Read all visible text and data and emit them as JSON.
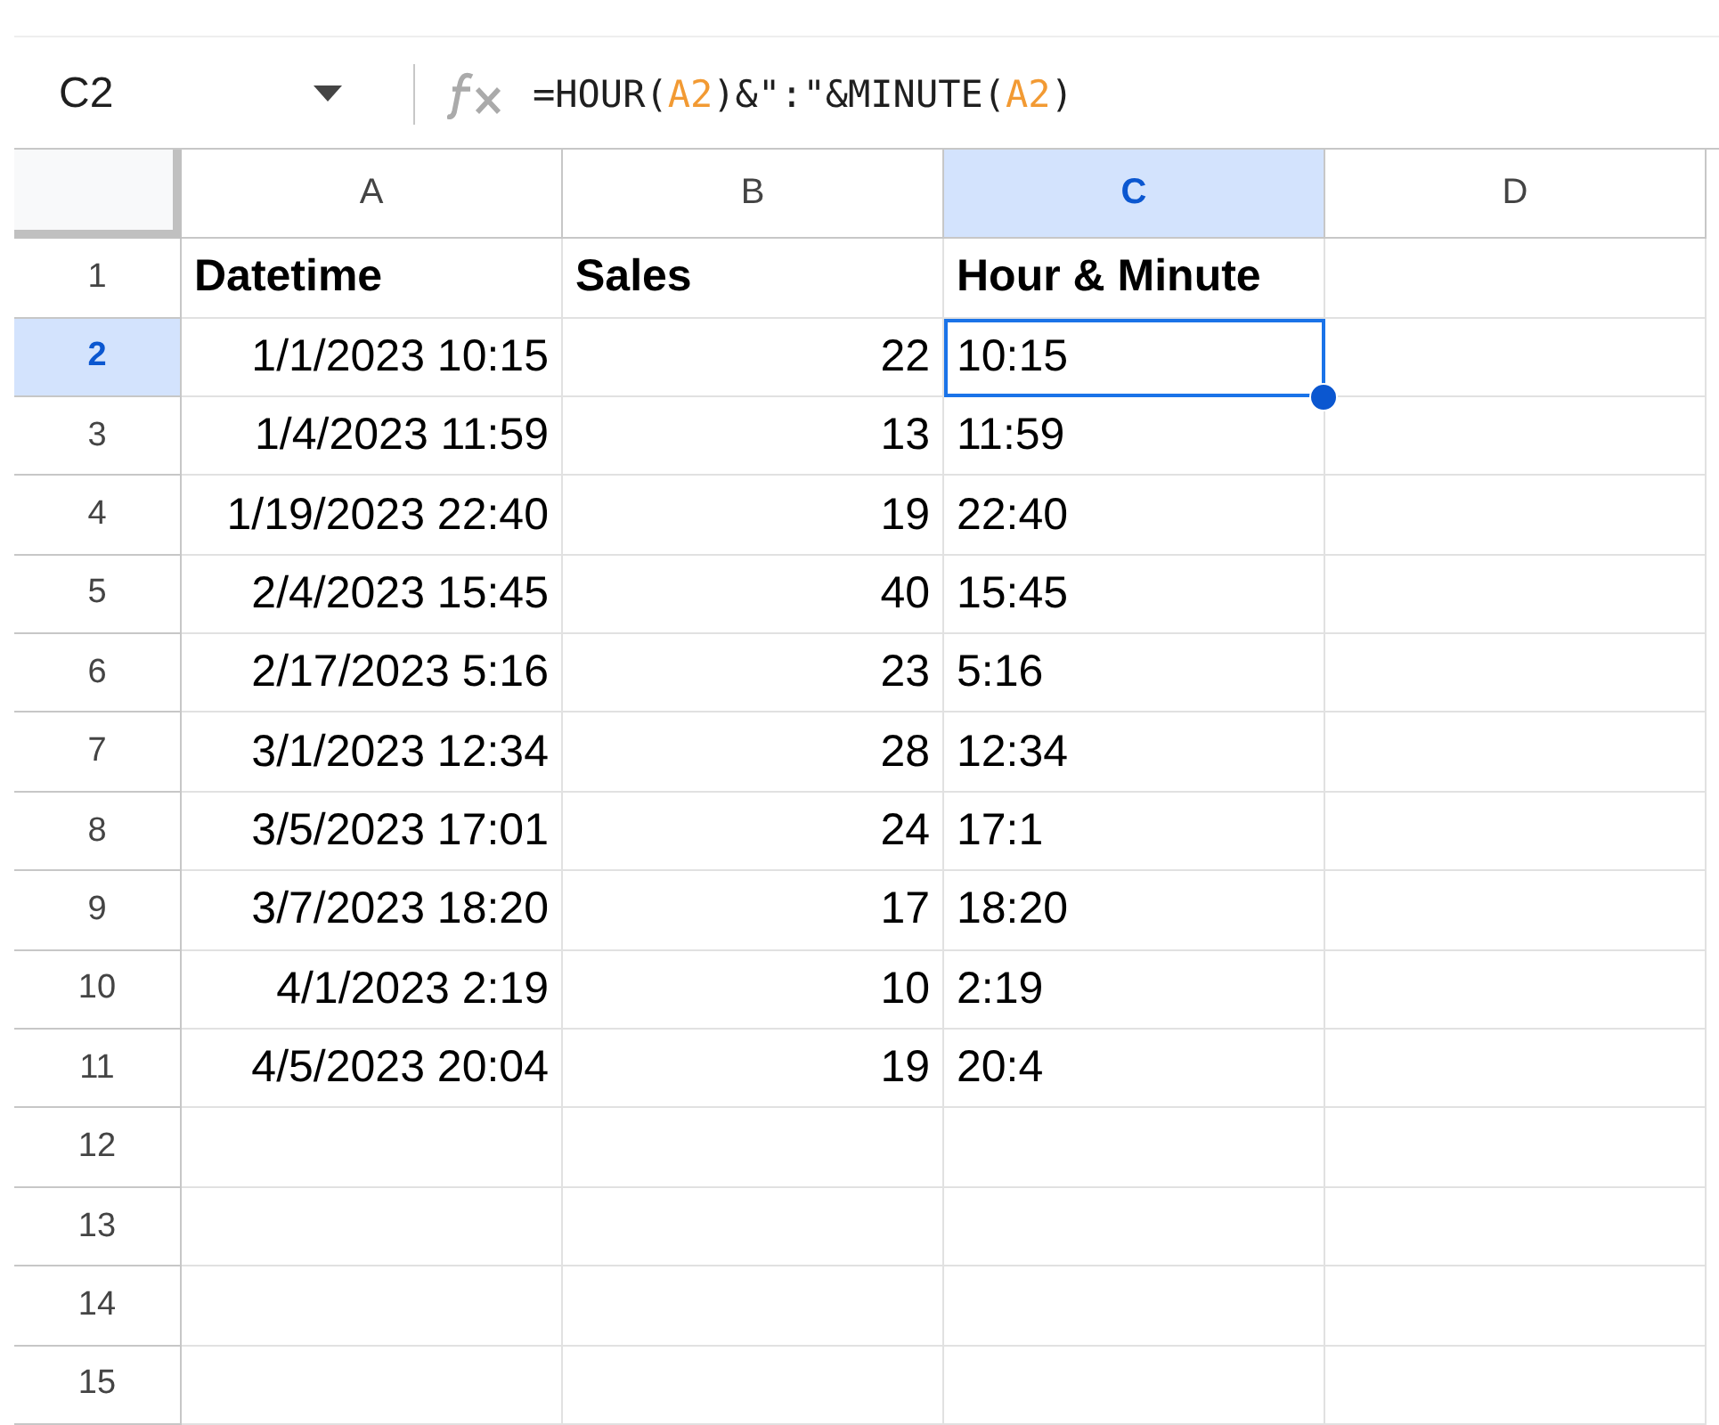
{
  "name_box": "C2",
  "formula": [
    {
      "kind": "text",
      "text": "=HOUR("
    },
    {
      "kind": "ref",
      "text": "A2"
    },
    {
      "kind": "text",
      "text": ")&\":\"&MINUTE("
    },
    {
      "kind": "ref",
      "text": "A2"
    },
    {
      "kind": "text",
      "text": ")"
    }
  ],
  "columns": [
    {
      "label": "A",
      "selected": false
    },
    {
      "label": "B",
      "selected": false
    },
    {
      "label": "C",
      "selected": true
    },
    {
      "label": "D",
      "selected": false
    }
  ],
  "rows": [
    {
      "label": "1",
      "selected": false,
      "cells": [
        {
          "text": "Datetime",
          "kind": "header",
          "selected": false
        },
        {
          "text": "Sales",
          "kind": "header",
          "selected": false
        },
        {
          "text": "Hour & Minute",
          "kind": "header",
          "selected": false
        }
      ]
    },
    {
      "label": "2",
      "selected": true,
      "cells": [
        {
          "text": "1/1/2023 10:15",
          "kind": "number",
          "selected": false
        },
        {
          "text": "22",
          "kind": "number",
          "selected": false
        },
        {
          "text": "10:15",
          "kind": "text",
          "selected": true
        }
      ]
    },
    {
      "label": "3",
      "selected": false,
      "cells": [
        {
          "text": "1/4/2023 11:59",
          "kind": "number",
          "selected": false
        },
        {
          "text": "13",
          "kind": "number",
          "selected": false
        },
        {
          "text": "11:59",
          "kind": "text",
          "selected": false
        }
      ]
    },
    {
      "label": "4",
      "selected": false,
      "cells": [
        {
          "text": "1/19/2023 22:40",
          "kind": "number",
          "selected": false
        },
        {
          "text": "19",
          "kind": "number",
          "selected": false
        },
        {
          "text": "22:40",
          "kind": "text",
          "selected": false
        }
      ]
    },
    {
      "label": "5",
      "selected": false,
      "cells": [
        {
          "text": "2/4/2023 15:45",
          "kind": "number",
          "selected": false
        },
        {
          "text": "40",
          "kind": "number",
          "selected": false
        },
        {
          "text": "15:45",
          "kind": "text",
          "selected": false
        }
      ]
    },
    {
      "label": "6",
      "selected": false,
      "cells": [
        {
          "text": "2/17/2023 5:16",
          "kind": "number",
          "selected": false
        },
        {
          "text": "23",
          "kind": "number",
          "selected": false
        },
        {
          "text": "5:16",
          "kind": "text",
          "selected": false
        }
      ]
    },
    {
      "label": "7",
      "selected": false,
      "cells": [
        {
          "text": "3/1/2023 12:34",
          "kind": "number",
          "selected": false
        },
        {
          "text": "28",
          "kind": "number",
          "selected": false
        },
        {
          "text": "12:34",
          "kind": "text",
          "selected": false
        }
      ]
    },
    {
      "label": "8",
      "selected": false,
      "cells": [
        {
          "text": "3/5/2023 17:01",
          "kind": "number",
          "selected": false
        },
        {
          "text": "24",
          "kind": "number",
          "selected": false
        },
        {
          "text": "17:1",
          "kind": "text",
          "selected": false
        }
      ]
    },
    {
      "label": "9",
      "selected": false,
      "cells": [
        {
          "text": "3/7/2023 18:20",
          "kind": "number",
          "selected": false
        },
        {
          "text": "17",
          "kind": "number",
          "selected": false
        },
        {
          "text": "18:20",
          "kind": "text",
          "selected": false
        }
      ]
    },
    {
      "label": "10",
      "selected": false,
      "cells": [
        {
          "text": "4/1/2023 2:19",
          "kind": "number",
          "selected": false
        },
        {
          "text": "10",
          "kind": "number",
          "selected": false
        },
        {
          "text": "2:19",
          "kind": "text",
          "selected": false
        }
      ]
    },
    {
      "label": "11",
      "selected": false,
      "cells": [
        {
          "text": "4/5/2023 20:04",
          "kind": "number",
          "selected": false
        },
        {
          "text": "19",
          "kind": "number",
          "selected": false
        },
        {
          "text": "20:4",
          "kind": "text",
          "selected": false
        }
      ]
    },
    {
      "label": "12",
      "selected": false
    },
    {
      "label": "13",
      "selected": false
    },
    {
      "label": "14",
      "selected": false
    },
    {
      "label": "15",
      "selected": false
    }
  ]
}
